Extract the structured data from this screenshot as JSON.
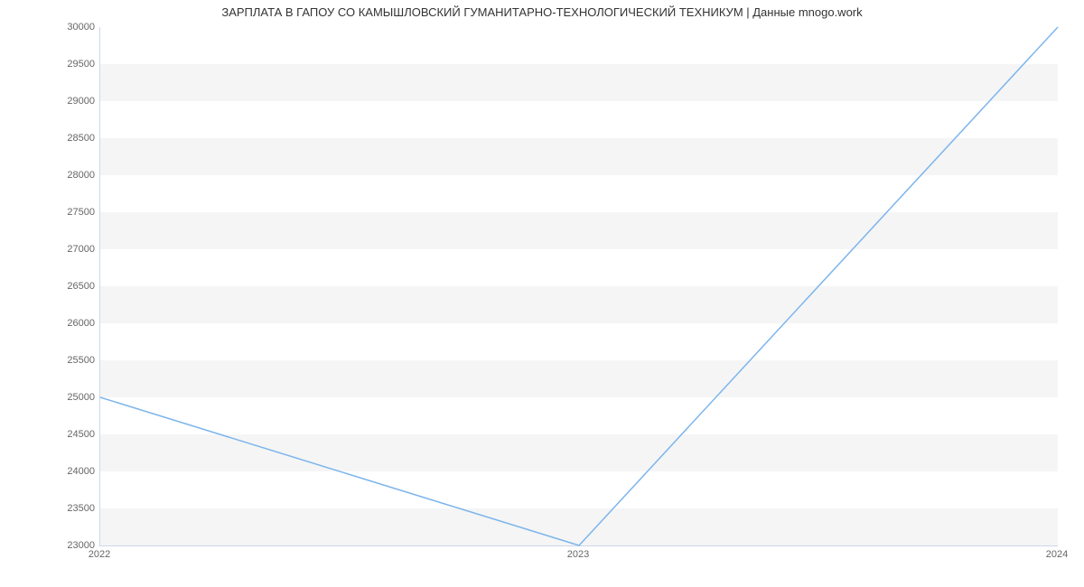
{
  "chart_data": {
    "type": "line",
    "title": "ЗАРПЛАТА В ГАПОУ СО КАМЫШЛОВСКИЙ ГУМАНИТАРНО-ТЕХНОЛОГИЧЕСКИЙ ТЕХНИКУМ | Данные mnogo.work",
    "x": [
      "2022",
      "2023",
      "2024"
    ],
    "values": [
      25000,
      23000,
      30000
    ],
    "xlabel": "",
    "ylabel": "",
    "ylim": [
      23000,
      30000
    ],
    "y_ticks": [
      23000,
      23500,
      24000,
      24500,
      25000,
      25500,
      26000,
      26500,
      27000,
      27500,
      28000,
      28500,
      29000,
      29500,
      30000
    ],
    "line_color": "#7cb5ec"
  }
}
